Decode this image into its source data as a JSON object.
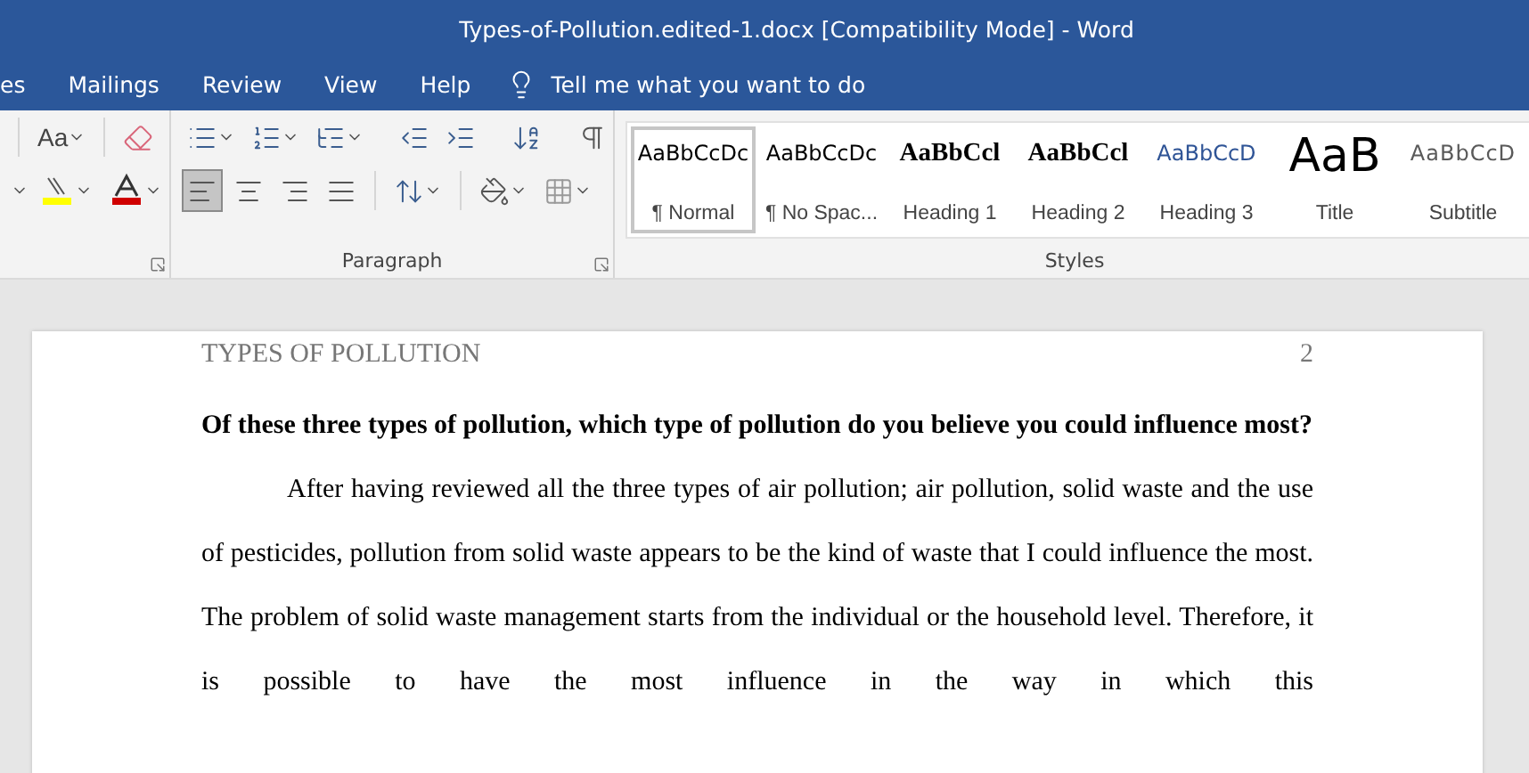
{
  "window": {
    "title": "Types-of-Pollution.edited-1.docx [Compatibility Mode]  -  Word"
  },
  "tabs": [
    {
      "label": "es",
      "selected": false
    },
    {
      "label": "Mailings",
      "selected": false
    },
    {
      "label": "Review",
      "selected": false
    },
    {
      "label": "View",
      "selected": false
    },
    {
      "label": "Help",
      "selected": false
    }
  ],
  "tell_me": {
    "placeholder": "Tell me what you want to do"
  },
  "font_group": {
    "change_case": "Aa"
  },
  "paragraph_group": {
    "label": "Paragraph",
    "alignment": [
      {
        "kind": "left",
        "selected": true
      },
      {
        "kind": "center",
        "selected": false
      },
      {
        "kind": "right",
        "selected": false
      },
      {
        "kind": "justify",
        "selected": false
      }
    ]
  },
  "styles_group": {
    "label": "Styles",
    "styles": [
      {
        "preview": "AaBbCcDc",
        "label": "¶ Normal",
        "kind": "normal",
        "selected": true
      },
      {
        "preview": "AaBbCcDc",
        "label": "¶ No Spac...",
        "kind": "normal",
        "selected": false
      },
      {
        "preview": "AaBbCcl",
        "label": "Heading 1",
        "kind": "heading",
        "selected": false
      },
      {
        "preview": "AaBbCcl",
        "label": "Heading 2",
        "kind": "heading",
        "selected": false
      },
      {
        "preview": "AaBbCcD",
        "label": "Heading 3",
        "kind": "subheading",
        "selected": false
      },
      {
        "preview": "AaB",
        "label": "Title",
        "kind": "title",
        "selected": false
      },
      {
        "preview": "AaBbCcD",
        "label": "Subtitle",
        "kind": "subtitle",
        "selected": false
      }
    ]
  },
  "document": {
    "header": "TYPES OF POLLUTION",
    "page_number": "2",
    "question": "Of these three types of pollution, which type of pollution do you believe you could influence most?",
    "paragraph": "After having reviewed all the three types of air pollution; air pollution, solid waste and the use of pesticides, pollution from solid waste appears to be the kind of waste that I could influence the most. The problem of solid waste management starts from the individual or the household level. Therefore, it is possible to have the most influence in the way in which this"
  }
}
